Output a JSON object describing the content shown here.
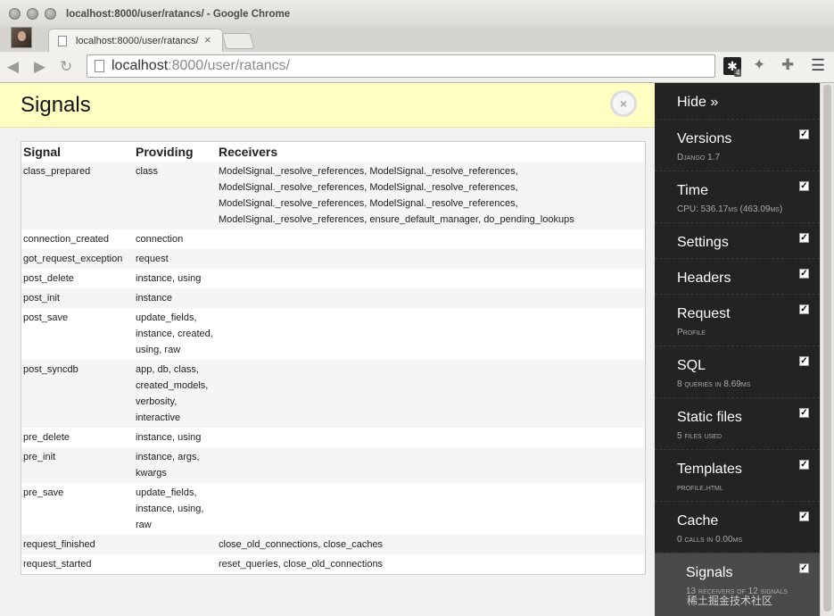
{
  "window": {
    "title": "localhost:8000/user/ratancs/ - Google Chrome"
  },
  "tab": {
    "title": "localhost:8000/user/ratancs/",
    "close": "×"
  },
  "omnibox": {
    "host": "localhost",
    "rest": ":8000/user/ratancs/"
  },
  "toolbar": {
    "ext_badge": "4"
  },
  "panel": {
    "title": "Signals",
    "close": "×"
  },
  "table": {
    "headers": [
      "Signal",
      "Providing",
      "Receivers"
    ],
    "rows": [
      {
        "signal": "class_prepared",
        "providing": "class",
        "receivers": "ModelSignal._resolve_references, ModelSignal._resolve_references, ModelSignal._resolve_references, ModelSignal._resolve_references, ModelSignal._resolve_references, ModelSignal._resolve_references, ModelSignal._resolve_references, ensure_default_manager, do_pending_lookups"
      },
      {
        "signal": "connection_created",
        "providing": "connection",
        "receivers": ""
      },
      {
        "signal": "got_request_exception",
        "providing": "request",
        "receivers": ""
      },
      {
        "signal": "post_delete",
        "providing": "instance, using",
        "receivers": ""
      },
      {
        "signal": "post_init",
        "providing": "instance",
        "receivers": ""
      },
      {
        "signal": "post_save",
        "providing": "update_fields, instance, created, using, raw",
        "receivers": ""
      },
      {
        "signal": "post_syncdb",
        "providing": "app, db, class, created_models, verbosity, interactive",
        "receivers": ""
      },
      {
        "signal": "pre_delete",
        "providing": "instance, using",
        "receivers": ""
      },
      {
        "signal": "pre_init",
        "providing": "instance, args, kwargs",
        "receivers": ""
      },
      {
        "signal": "pre_save",
        "providing": "update_fields, instance, using, raw",
        "receivers": ""
      },
      {
        "signal": "request_finished",
        "providing": "",
        "receivers": "close_old_connections, close_caches"
      },
      {
        "signal": "request_started",
        "providing": "",
        "receivers": "reset_queries, close_old_connections"
      }
    ]
  },
  "sidebar": {
    "hide": "Hide »",
    "items": [
      {
        "title": "Versions",
        "sub": "Django 1.7"
      },
      {
        "title": "Time",
        "sub": "CPU: 536.17ms (463.09ms)"
      },
      {
        "title": "Settings",
        "sub": ""
      },
      {
        "title": "Headers",
        "sub": ""
      },
      {
        "title": "Request",
        "sub": "Profile"
      },
      {
        "title": "SQL",
        "sub": "8 queries in 8.69ms"
      },
      {
        "title": "Static files",
        "sub": "5 files used"
      },
      {
        "title": "Templates",
        "sub": "profile.html"
      },
      {
        "title": "Cache",
        "sub": "0 calls in 0.00ms"
      },
      {
        "title": "Signals",
        "sub": "13 receivers of 12 signals"
      }
    ]
  },
  "watermark": "稀土掘金技术社区"
}
